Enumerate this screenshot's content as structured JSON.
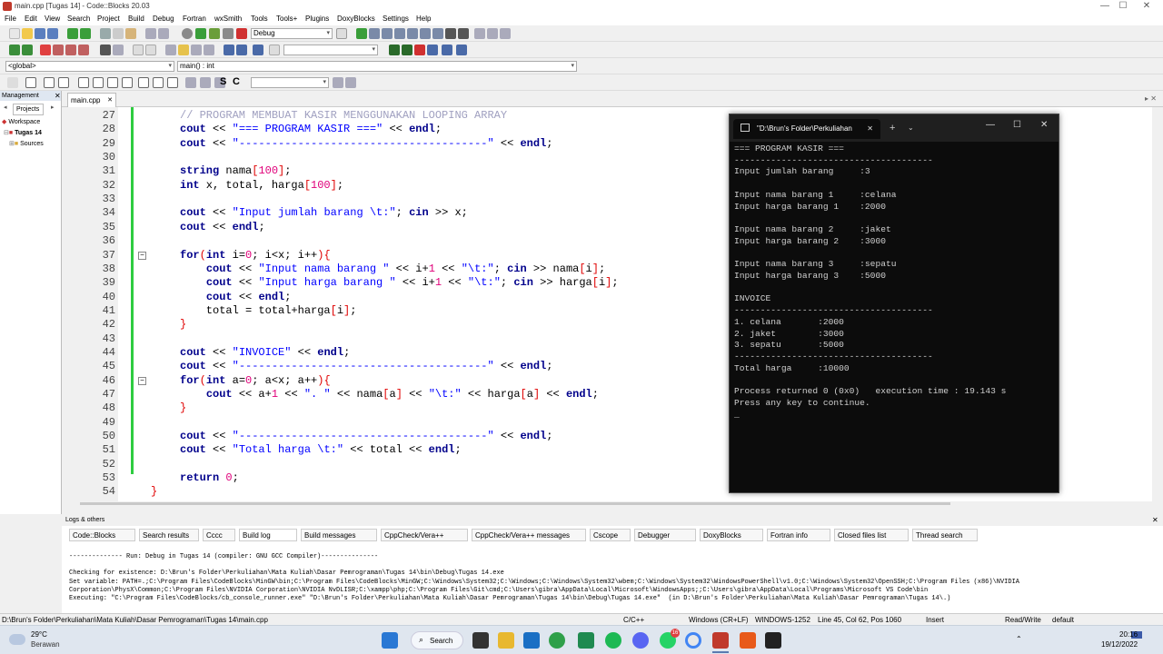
{
  "window": {
    "title": "main.cpp [Tugas 14] - Code::Blocks 20.03",
    "controls": [
      "—",
      "☐",
      "✕"
    ]
  },
  "menu": [
    "File",
    "Edit",
    "View",
    "Search",
    "Project",
    "Build",
    "Debug",
    "Fortran",
    "wxSmith",
    "Tools",
    "Tools+",
    "Plugins",
    "DoxyBlocks",
    "Settings",
    "Help"
  ],
  "toolbar": {
    "build_target": "Debug",
    "scope": "<global>",
    "function": "main() : int",
    "text_s": "S",
    "text_c": "C"
  },
  "management": {
    "title": "Management",
    "tab": "Projects",
    "workspace": "Workspace",
    "project": "Tugas 14",
    "sources": "Sources"
  },
  "editor": {
    "tab": "main.cpp",
    "lines": [
      {
        "n": "27",
        "html": "<span class='cmt'>// PROGRAM MEMBUAT KASIR MENGGUNAKAN LOOPING ARRAY</span>"
      },
      {
        "n": "28",
        "html": "<span class='kw'>cout</span> &lt;&lt; <span class='str'>\"=== PROGRAM KASIR ===\"</span> &lt;&lt; <span class='kw'>endl</span>;"
      },
      {
        "n": "29",
        "html": "<span class='kw'>cout</span> &lt;&lt; <span class='str'>\"--------------------------------------\"</span> &lt;&lt; <span class='kw'>endl</span>;"
      },
      {
        "n": "30",
        "html": ""
      },
      {
        "n": "31",
        "html": "<span class='kw'>string</span> nama<span class='op'>[</span><span class='num'>100</span><span class='op'>]</span>;"
      },
      {
        "n": "32",
        "html": "<span class='kw'>int</span> x, total, harga<span class='op'>[</span><span class='num'>100</span><span class='op'>]</span>;"
      },
      {
        "n": "33",
        "html": ""
      },
      {
        "n": "34",
        "html": "<span class='kw'>cout</span> &lt;&lt; <span class='str'>\"Input jumlah barang \\t:\"</span>; <span class='kw'>cin</span> &gt;&gt; x;"
      },
      {
        "n": "35",
        "html": "<span class='kw'>cout</span> &lt;&lt; <span class='kw'>endl</span>;"
      },
      {
        "n": "36",
        "html": ""
      },
      {
        "n": "37",
        "html": "<span class='kw'>for</span><span class='op'>(</span><span class='kw'>int</span> i=<span class='num'>0</span>; i&lt;x; i++<span class='op'>){</span>",
        "fold": true
      },
      {
        "n": "38",
        "html": "    <span class='kw'>cout</span> &lt;&lt; <span class='str'>\"Input nama barang \"</span> &lt;&lt; i+<span class='num'>1</span> &lt;&lt; <span class='str'>\"\\t:\"</span>; <span class='kw'>cin</span> &gt;&gt; nama<span class='op'>[</span>i<span class='op'>]</span>;"
      },
      {
        "n": "39",
        "html": "    <span class='kw'>cout</span> &lt;&lt; <span class='str'>\"Input harga barang \"</span> &lt;&lt; i+<span class='num'>1</span> &lt;&lt; <span class='str'>\"\\t:\"</span>; <span class='kw'>cin</span> &gt;&gt; harga<span class='op'>[</span>i<span class='op'>]</span>;"
      },
      {
        "n": "40",
        "html": "    <span class='kw'>cout</span> &lt;&lt; <span class='kw'>endl</span>;"
      },
      {
        "n": "41",
        "html": "    total = total+harga<span class='op'>[</span>i<span class='op'>]</span>;"
      },
      {
        "n": "42",
        "html": "<span class='op'>}</span>"
      },
      {
        "n": "43",
        "html": ""
      },
      {
        "n": "44",
        "html": "<span class='kw'>cout</span> &lt;&lt; <span class='str'>\"INVOICE\"</span> &lt;&lt; <span class='kw'>endl</span>;"
      },
      {
        "n": "45",
        "html": "<span class='kw'>cout</span> &lt;&lt; <span class='str'>\"--------------------------------------\"</span> &lt;&lt; <span class='kw'>endl</span>;"
      },
      {
        "n": "46",
        "html": "<span class='kw'>for</span><span class='op'>(</span><span class='kw'>int</span> a=<span class='num'>0</span>; a&lt;x; a++<span class='op'>){</span>",
        "fold": true
      },
      {
        "n": "47",
        "html": "    <span class='kw'>cout</span> &lt;&lt; a+<span class='num'>1</span> &lt;&lt; <span class='str'>\". \"</span> &lt;&lt; nama<span class='op'>[</span>a<span class='op'>]</span> &lt;&lt; <span class='str'>\"\\t:\"</span> &lt;&lt; harga<span class='op'>[</span>a<span class='op'>]</span> &lt;&lt; <span class='kw'>endl</span>;"
      },
      {
        "n": "48",
        "html": "<span class='op'>}</span>"
      },
      {
        "n": "49",
        "html": ""
      },
      {
        "n": "50",
        "html": "<span class='kw'>cout</span> &lt;&lt; <span class='str'>\"--------------------------------------\"</span> &lt;&lt; <span class='kw'>endl</span>;"
      },
      {
        "n": "51",
        "html": "<span class='kw'>cout</span> &lt;&lt; <span class='str'>\"Total harga \\t:\"</span> &lt;&lt; total &lt;&lt; <span class='kw'>endl</span>;"
      },
      {
        "n": "52",
        "html": ""
      },
      {
        "n": "53",
        "html": "<span class='kw'>return</span> <span class='num'>0</span>;"
      },
      {
        "n": "54",
        "html": "<span class='op'>}</span>",
        "outdent": true
      }
    ]
  },
  "logs": {
    "title": "Logs & others",
    "tabs": [
      "Code::Blocks",
      "Search results",
      "Cccc",
      "Build log",
      "Build messages",
      "CppCheck/Vera++",
      "CppCheck/Vera++ messages",
      "Cscope",
      "Debugger",
      "DoxyBlocks",
      "Fortran info",
      "Closed files list",
      "Thread search"
    ],
    "lines": [
      "-------------- Run: Debug in Tugas 14 (compiler: GNU GCC Compiler)---------------",
      "",
      "Checking for existence: D:\\Brun's Folder\\Perkuliahan\\Mata Kuliah\\Dasar Pemrograman\\Tugas 14\\bin\\Debug\\Tugas 14.exe",
      "Set variable: PATH=.;C:\\Program Files\\CodeBlocks\\MinGW\\bin;C:\\Program Files\\CodeBlocks\\MinGW;C:\\Windows\\System32;C:\\Windows;C:\\Windows\\System32\\wbem;C:\\Windows\\System32\\WindowsPowerShell\\v1.0;C:\\Windows\\System32\\OpenSSH;C:\\Program Files (x86)\\NVIDIA",
      "Corporation\\PhysX\\Common;C:\\Program Files\\NVIDIA Corporation\\NVIDIA NvDLISR;C:\\xampp\\php;C:\\Program Files\\Git\\cmd;C:\\Users\\gibra\\AppData\\Local\\Microsoft\\WindowsApps;;C:\\Users\\gibra\\AppData\\Local\\Programs\\Microsoft VS Code\\bin",
      "Executing: \"C:\\Program Files\\CodeBlocks/cb_console_runner.exe\" \"D:\\Brun's Folder\\Perkuliahan\\Mata Kuliah\\Dasar Pemrograman\\Tugas 14\\bin\\Debug\\Tugas 14.exe\"  (in D:\\Brun's Folder\\Perkuliahan\\Mata Kuliah\\Dasar Pemrograman\\Tugas 14\\.)"
    ]
  },
  "statusbar": {
    "path": "D:\\Brun's Folder\\Perkuliahan\\Mata Kuliah\\Dasar Pemrograman\\Tugas 14\\main.cpp",
    "lang": "C/C++",
    "eol": "Windows (CR+LF)",
    "encoding": "WINDOWS-1252",
    "position": "Line 45, Col 62, Pos 1060",
    "mode": "Insert",
    "access": "Read/Write",
    "profile": "default"
  },
  "taskbar": {
    "temp": "29°C",
    "weather": "Berawan",
    "search": "Search",
    "time": "20:16",
    "date": "19/12/2022",
    "badge": "16"
  },
  "console": {
    "tab_title": "\"D:\\Brun's Folder\\Perkuliahan",
    "lines": [
      "=== PROGRAM KASIR ===",
      "--------------------------------------",
      "Input jumlah barang     :3",
      "",
      "Input nama barang 1     :celana",
      "Input harga barang 1    :2000",
      "",
      "Input nama barang 2     :jaket",
      "Input harga barang 2    :3000",
      "",
      "Input nama barang 3     :sepatu",
      "Input harga barang 3    :5000",
      "",
      "INVOICE",
      "--------------------------------------",
      "1. celana       :2000",
      "2. jaket        :3000",
      "3. sepatu       :5000",
      "--------------------------------------",
      "Total harga     :10000",
      "",
      "Process returned 0 (0x0)   execution time : 19.143 s",
      "Press any key to continue.",
      "_"
    ]
  }
}
